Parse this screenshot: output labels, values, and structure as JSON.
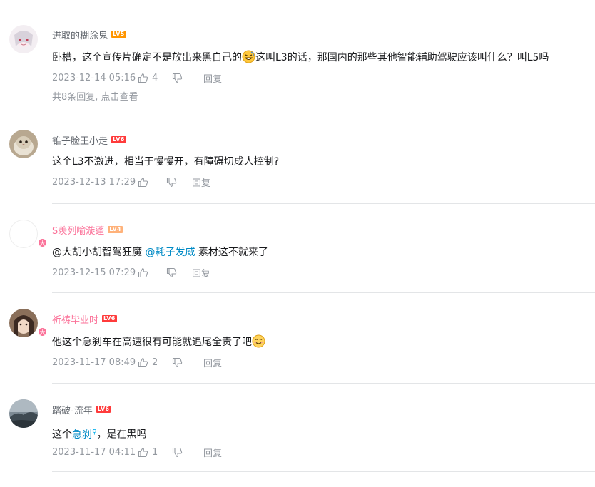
{
  "comments": [
    {
      "username": "进取的糊涂鬼",
      "level": "LV5",
      "level_color": "#ff9500",
      "text_a": "卧槽，这个宣传片确定不是放出来黑自己的",
      "emoji": "grin-emoji",
      "text_b": "这叫L3的话，那国内的那些其他智能辅助驾驶应该叫什么？叫L5吗",
      "time": "2023-12-14 05:16",
      "likes": "4",
      "reply_label": "回复",
      "sub_replies": "共8条回复, 点击查看"
    },
    {
      "username": "锥子脸王小走",
      "level": "LV6",
      "level_color": "#ff3b3b",
      "text": "这个L3不激进，相当于慢慢开，有障碍切成人控制?",
      "time": "2023-12-13 17:29",
      "likes": "",
      "reply_label": "回复"
    },
    {
      "username": "S羡列喻漩蓬",
      "level": "LV4",
      "level_color": "#ffb27a",
      "mention1": "@大胡小胡智驾狂魔",
      "mention2": "@耗子发威",
      "text_after": "素材这不就来了",
      "time": "2023-12-15 07:29",
      "likes": "",
      "reply_label": "回复"
    },
    {
      "username": "祈祷毕业时",
      "level": "LV6",
      "level_color": "#ff3b3b",
      "text": "他这个急刹车在高速很有可能就追尾全责了吧",
      "emoji": "smile-emoji",
      "time": "2023-11-17 08:49",
      "likes": "2",
      "reply_label": "回复"
    },
    {
      "username": "踏破-流年",
      "level": "LV6",
      "level_color": "#ff3b3b",
      "text_a": "这个",
      "keyword": "急刹",
      "text_b": "，是在黑吗",
      "time": "2023-11-17 04:11",
      "likes": "1",
      "reply_label": "回复"
    }
  ],
  "vip_badge": "大"
}
